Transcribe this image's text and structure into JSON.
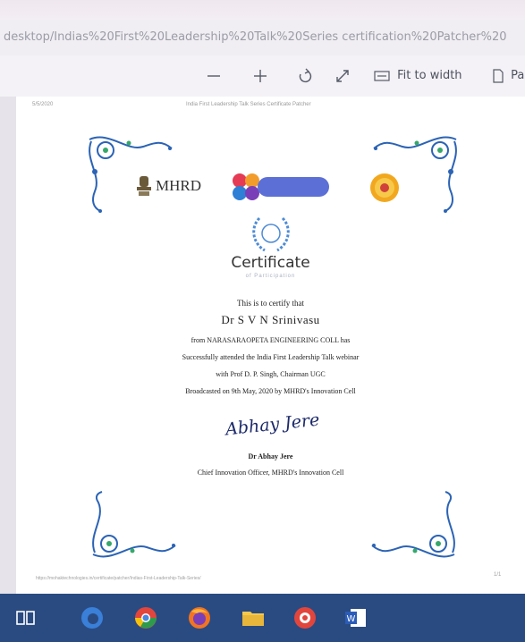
{
  "browser": {
    "url": "desktop/Indias%20First%20Leadership%20Talk%20Series certification%20Patcher%20"
  },
  "toolbar": {
    "fit_label": "Fit to width",
    "page_label": "Pa"
  },
  "header": {
    "date": "5/5/2020",
    "title": "India First Leadership Talk Series Certificate Patcher"
  },
  "logos": {
    "mhrd": "MHRD"
  },
  "certificate": {
    "title": "Certificate",
    "subtitle": "of Participation",
    "intro": "This is to certify that",
    "name": "Dr S V N Srinivasu",
    "line_from": "from NARASARAOPETA ENGINEERING COLL has",
    "line_attended": "Successfully attended the India First Leadership Talk webinar",
    "line_with": "with Prof D. P. Singh, Chairman UGC",
    "line_broadcast": "Broadcasted on 9th May, 2020 by MHRD's Innovation Cell",
    "signature": "Abhay Jere",
    "signer_name": "Dr Abhay Jere",
    "signer_title": "Chief Innovation Officer, MHRD's Innovation Cell"
  },
  "footer": {
    "url": "https://mohaktechnologies.in/certificate/patcher/Indias-First-Leadership-Talk-Series/",
    "page": "1/1"
  },
  "colors": {
    "ornament": "#2b63b5",
    "taskbar": "#2a4b82"
  }
}
